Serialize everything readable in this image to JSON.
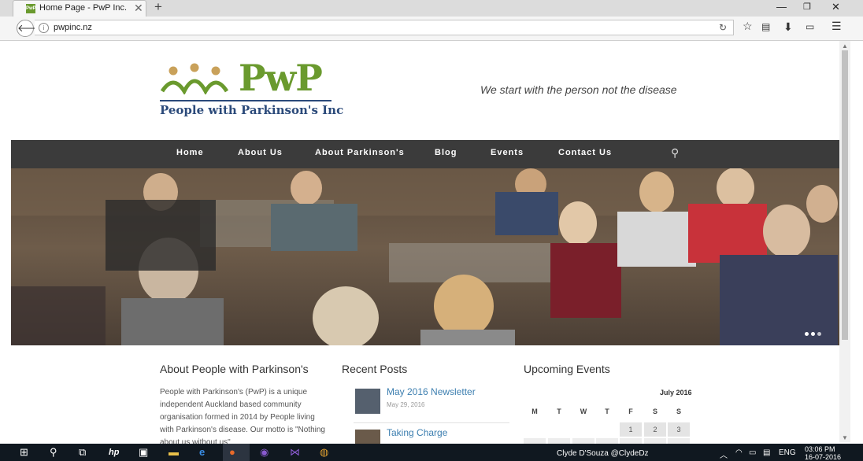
{
  "browser": {
    "tab_title": "Home Page - PwP Inc.",
    "tab_favicon": "PwP",
    "new_tab": "+",
    "url": "pwpinc.nz"
  },
  "site": {
    "logo_text": "PwP",
    "logo_subtitle": "People with Parkinson's Inc",
    "tagline": "We start with the person not the disease",
    "nav": [
      "Home",
      "About Us",
      "About Parkinson's",
      "Blog",
      "Events",
      "Contact Us"
    ]
  },
  "about": {
    "heading": "About People with Parkinson's",
    "body": "People with Parkinson's (PwP) is a unique independent Auckland based community organisation formed in 2014 by People living with Parkinson's disease. Our motto is \"Nothing about us without us\""
  },
  "recent_posts": {
    "heading": "Recent Posts",
    "posts": [
      {
        "title": "May 2016 Newsletter",
        "date": "May 29, 2016"
      },
      {
        "title": "Taking Charge",
        "date": ""
      }
    ]
  },
  "events": {
    "heading": "Upcoming Events",
    "month": "July 2016",
    "day_headers": [
      "M",
      "T",
      "W",
      "T",
      "F",
      "S",
      "S"
    ],
    "first_week": [
      "1",
      "2",
      "3"
    ]
  },
  "taskbar": {
    "user": "Clyde D'Souza @ClydeDz",
    "lang": "ENG",
    "time": "03:06 PM",
    "date": "16-07-2016"
  },
  "colors": {
    "brand_green": "#6a9a2e",
    "brand_navy": "#2b4a7a",
    "nav_bg": "#3b3b3b",
    "link_blue": "#3d7fb0"
  }
}
